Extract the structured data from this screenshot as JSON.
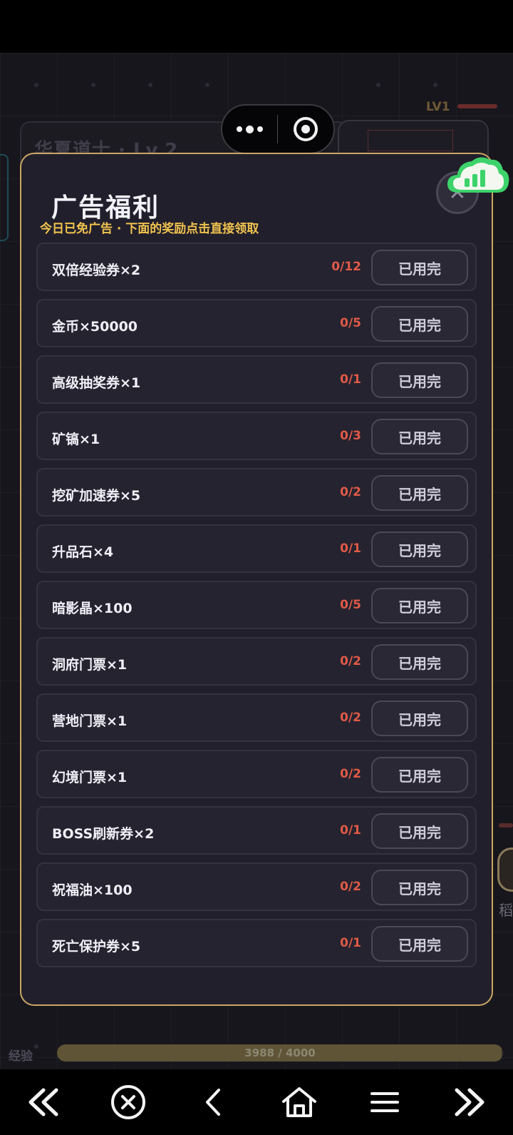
{
  "background": {
    "header_title": "华夏道士 · Lv.2",
    "level_label": "LV1"
  },
  "dialog": {
    "title": "广告福利",
    "subtitle": "今日已免广告 · 下面的奖励点击直接领取",
    "items": [
      {
        "label": "双倍经验券×2",
        "count": "0/12",
        "button": "已用完"
      },
      {
        "label": "金币×50000",
        "count": "0/5",
        "button": "已用完"
      },
      {
        "label": "高级抽奖券×1",
        "count": "0/1",
        "button": "已用完"
      },
      {
        "label": "矿镐×1",
        "count": "0/3",
        "button": "已用完"
      },
      {
        "label": "挖矿加速券×5",
        "count": "0/2",
        "button": "已用完"
      },
      {
        "label": "升品石×4",
        "count": "0/1",
        "button": "已用完"
      },
      {
        "label": "暗影晶×100",
        "count": "0/5",
        "button": "已用完"
      },
      {
        "label": "洞府门票×1",
        "count": "0/2",
        "button": "已用完"
      },
      {
        "label": "营地门票×1",
        "count": "0/2",
        "button": "已用完"
      },
      {
        "label": "幻境门票×1",
        "count": "0/2",
        "button": "已用完"
      },
      {
        "label": "BOSS刷新券×2",
        "count": "0/1",
        "button": "已用完"
      },
      {
        "label": "祝福油×100",
        "count": "0/2",
        "button": "已用完"
      },
      {
        "label": "死亡保护券×5",
        "count": "0/1",
        "button": "已用完"
      }
    ]
  },
  "exp": {
    "label": "经验",
    "text": "3988 / 4000",
    "current": 3988,
    "max": 4000
  },
  "right_edge_char": "稻",
  "colors": {
    "dialog_border": "#c9a664",
    "subtitle": "#f0c24e",
    "count": "#e05a48"
  },
  "icons": {
    "capsule_more": "more-dots-icon",
    "capsule_target": "target-icon",
    "close": "close-icon",
    "cloud": "cloud-signal-icon",
    "nav": [
      "double-chevron-left-icon",
      "circle-x-icon",
      "chevron-left-icon",
      "home-icon",
      "menu-icon",
      "double-chevron-right-icon"
    ]
  }
}
